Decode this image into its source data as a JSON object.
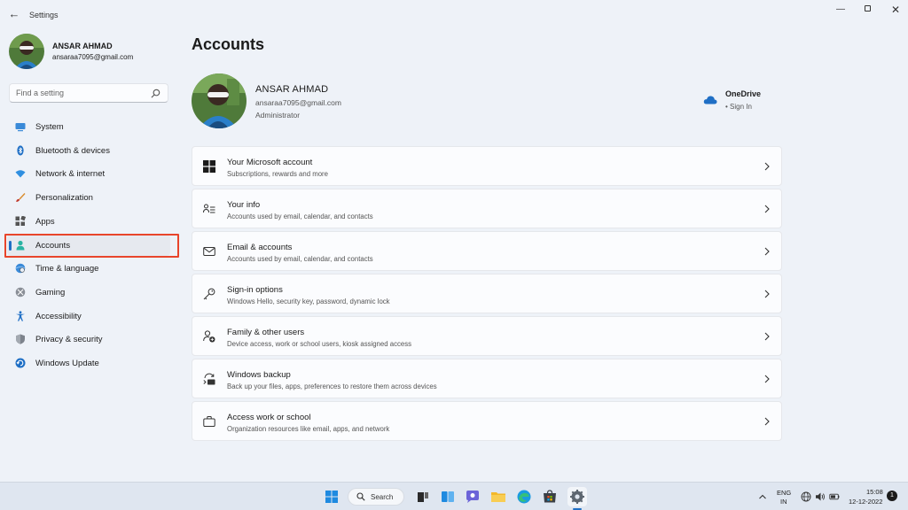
{
  "window": {
    "title": "Settings",
    "back_icon": "arrow-left-icon",
    "minimize_icon": "minimize-icon",
    "maximize_icon": "maximize-icon",
    "close_icon": "close-icon"
  },
  "profile": {
    "name": "ANSAR AHMAD",
    "email": "ansaraa7095@gmail.com"
  },
  "search": {
    "placeholder": "Find a setting"
  },
  "sidebar": {
    "items": [
      {
        "label": "System",
        "icon": "monitor-icon"
      },
      {
        "label": "Bluetooth & devices",
        "icon": "bluetooth-icon"
      },
      {
        "label": "Network & internet",
        "icon": "wifi-icon"
      },
      {
        "label": "Personalization",
        "icon": "brush-icon"
      },
      {
        "label": "Apps",
        "icon": "apps-icon"
      },
      {
        "label": "Accounts",
        "icon": "person-icon",
        "active": true
      },
      {
        "label": "Time & language",
        "icon": "globe-clock-icon"
      },
      {
        "label": "Gaming",
        "icon": "xbox-icon"
      },
      {
        "label": "Accessibility",
        "icon": "accessibility-icon"
      },
      {
        "label": "Privacy & security",
        "icon": "shield-icon"
      },
      {
        "label": "Windows Update",
        "icon": "update-icon"
      }
    ]
  },
  "main": {
    "title": "Accounts",
    "account": {
      "name": "ANSAR AHMAD",
      "email": "ansaraa7095@gmail.com",
      "role": "Administrator"
    },
    "onedrive": {
      "title": "OneDrive",
      "status": "• Sign In",
      "icon": "cloud-icon"
    },
    "cards": [
      {
        "title": "Your Microsoft account",
        "subtitle": "Subscriptions, rewards and more",
        "icon": "windows-logo-icon"
      },
      {
        "title": "Your info",
        "subtitle": "Accounts used by email, calendar, and contacts",
        "icon": "person-info-icon"
      },
      {
        "title": "Email & accounts",
        "subtitle": "Accounts used by email, calendar, and contacts",
        "icon": "mail-icon"
      },
      {
        "title": "Sign-in options",
        "subtitle": "Windows Hello, security key, password, dynamic lock",
        "icon": "key-icon"
      },
      {
        "title": "Family & other users",
        "subtitle": "Device access, work or school users, kiosk assigned access",
        "icon": "person-add-icon"
      },
      {
        "title": "Windows backup",
        "subtitle": "Back up your files, apps, preferences to restore them across devices",
        "icon": "backup-icon"
      },
      {
        "title": "Access work or school",
        "subtitle": "Organization resources like email, apps, and network",
        "icon": "briefcase-icon"
      }
    ]
  },
  "taskbar": {
    "search_label": "Search",
    "apps": [
      "start-icon",
      "search-icon",
      "task-view-icon",
      "widgets-icon",
      "teams-chat-icon",
      "file-explorer-icon",
      "edge-icon",
      "store-icon",
      "settings-icon"
    ],
    "tray": {
      "lang_line1": "ENG",
      "lang_line2": "IN",
      "time": "15:08",
      "date": "12-12-2022",
      "notification_count": "1"
    }
  },
  "colors": {
    "accent": "#1f6fc5",
    "highlight": "#e8452b",
    "background": "#eef2f8"
  }
}
